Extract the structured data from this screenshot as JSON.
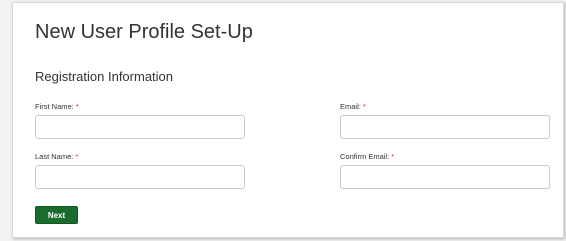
{
  "page": {
    "title": "New User Profile Set-Up"
  },
  "form": {
    "section_heading": "Registration Information",
    "required_marker": "*",
    "fields": {
      "first_name": {
        "label": "First Name:",
        "value": "",
        "placeholder": ""
      },
      "email": {
        "label": "Email:",
        "value": "",
        "placeholder": ""
      },
      "last_name": {
        "label": "Last Name:",
        "value": "",
        "placeholder": ""
      },
      "confirm_email": {
        "label": "Confirm Email:",
        "value": "",
        "placeholder": ""
      }
    },
    "next_label": "Next"
  },
  "colors": {
    "button_green": "#1a6b2e",
    "required_red": "#c0392b"
  }
}
